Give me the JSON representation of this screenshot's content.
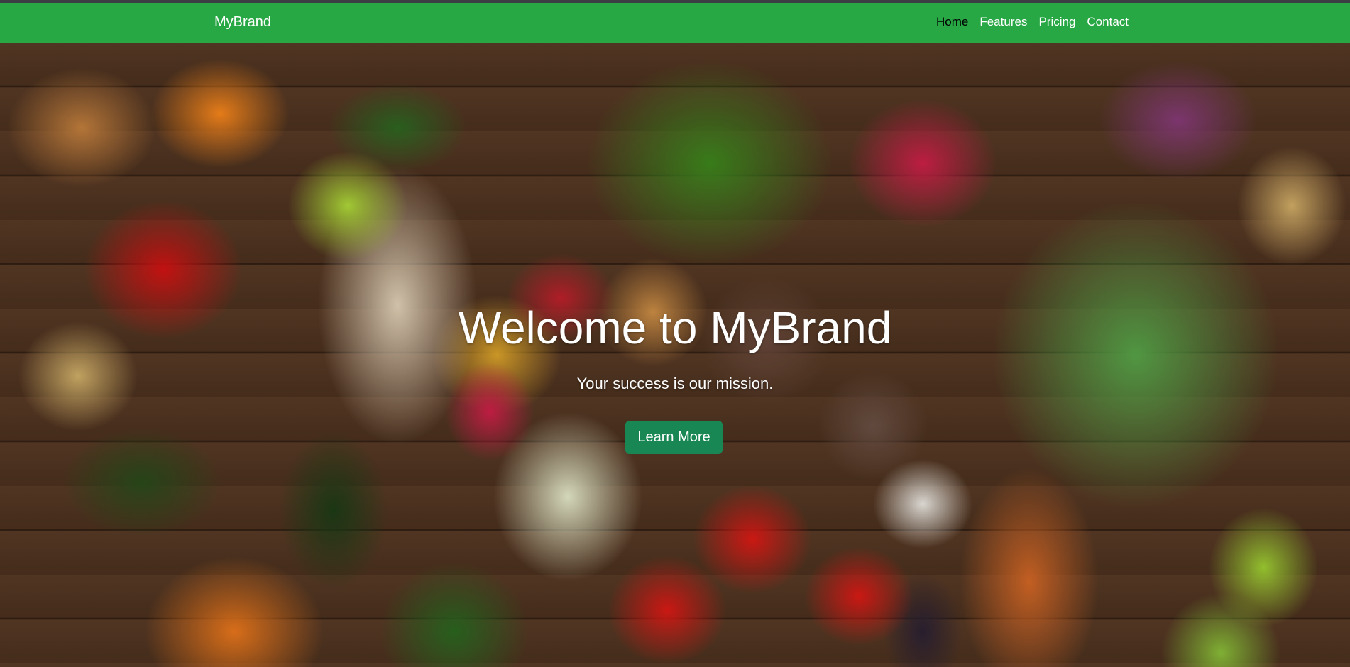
{
  "navbar": {
    "brand": "MyBrand",
    "items": [
      {
        "label": "Home",
        "active": true
      },
      {
        "label": "Features",
        "active": false
      },
      {
        "label": "Pricing",
        "active": false
      },
      {
        "label": "Contact",
        "active": false
      }
    ],
    "color": "#28a745"
  },
  "hero": {
    "title": "Welcome to MyBrand",
    "subtitle": "Your success is our mission.",
    "button_label": "Learn More",
    "button_color": "#198754",
    "background": "vegetables photo"
  }
}
